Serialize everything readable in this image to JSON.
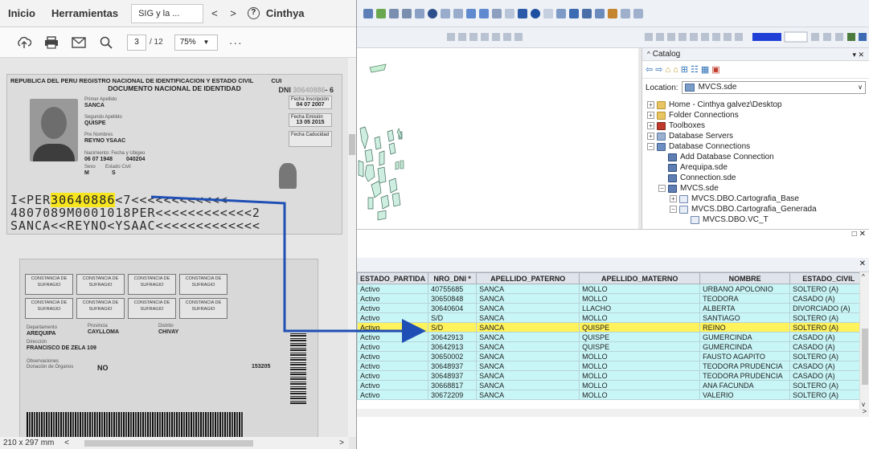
{
  "pdf": {
    "menu": {
      "inicio": "Inicio",
      "herramientas": "Herramientas",
      "tab": "SIG y la ...",
      "nav": "< >",
      "help": "?",
      "user": "Cinthya"
    },
    "toolbar": {
      "page_current": "3",
      "page_total": "/ 12",
      "zoom": "75%",
      "more": "···"
    },
    "status": {
      "page_size": "210 x 297 mm",
      "scroll_left": "<",
      "scroll_right": ">"
    },
    "dni_front": {
      "header": "REPUBLICA DEL PERU  REGISTRO NACIONAL DE IDENTIFICACION Y ESTADO CIVIL",
      "cui": "CUI",
      "title": "DOCUMENTO NACIONAL DE IDENTIDAD",
      "dni_label": "DNI",
      "dni_suffix": "- 6",
      "primer_apellido_label": "Primer Apellido",
      "primer_apellido": "SANCA",
      "segundo_apellido_label": "Segundo Apellido",
      "segundo_apellido": "QUISPE",
      "prenombres_label": "Pre Nombres",
      "prenombres": "REYNO YSAAC",
      "nacimiento_label": "Nacimiento: Fecha y Ubigeo",
      "nacimiento": "06 07 1948",
      "ubigeo": "040204",
      "sexo_label": "Sexo",
      "sexo": "M",
      "estado_civil_label": "Estado Civil",
      "estado_civil": "S",
      "fecha_inscripcion_label": "Fecha Inscripción",
      "fecha_inscripcion": "04 07 2007",
      "fecha_emision_label": "Fecha Emisión",
      "fecha_emision": "13 05 2015",
      "fecha_caducidad_label": "Fecha Caducidad",
      "mrz1_pre": "I<PER",
      "mrz1_hl": "30640886",
      "mrz1_post": "<7<<<<<<<<<<<<",
      "mrz2": "4807089M0001018PER<<<<<<<<<<<<2",
      "mrz3": "SANCA<<REYNO<YSAAC<<<<<<<<<<<<<"
    },
    "dni_back": {
      "stamp_text": "CONSTANCIA DE SUFRAGIO",
      "departamento_label": "Departamento",
      "departamento": "AREQUIPA",
      "provincia_label": "Provincia",
      "provincia": "CAYLLOMA",
      "distrito_label": "Distrito",
      "distrito": "CHIVAY",
      "direccion_label": "Dirección",
      "direccion": "FRANCISCO DE ZELA 109",
      "obs_label": "Observaciones",
      "obs": "Donación de Órganos",
      "obs_value": "NO",
      "grupo_code": "153205"
    }
  },
  "arcmap": {
    "catalog": {
      "title": "Catalog",
      "pin": "▾ ✕",
      "location_label": "Location:",
      "location_value": "MVCS.sde",
      "tree": [
        {
          "label": "Home - Cinthya galvez\\Desktop",
          "exp": "+",
          "icon": "folder",
          "indent": 0
        },
        {
          "label": "Folder Connections",
          "exp": "+",
          "icon": "folder",
          "indent": 0
        },
        {
          "label": "Toolboxes",
          "exp": "+",
          "icon": "box",
          "indent": 0
        },
        {
          "label": "Database Servers",
          "exp": "+",
          "icon": "srv",
          "indent": 0
        },
        {
          "label": "Database Connections",
          "exp": "−",
          "icon": "db",
          "indent": 0
        },
        {
          "label": "Add Database Connection",
          "exp": "",
          "icon": "conn",
          "indent": 1
        },
        {
          "label": "Arequipa.sde",
          "exp": "",
          "icon": "conn",
          "indent": 1
        },
        {
          "label": "Connection.sde",
          "exp": "",
          "icon": "conn",
          "indent": 1
        },
        {
          "label": "MVCS.sde",
          "exp": "−",
          "icon": "conn",
          "indent": 1
        },
        {
          "label": "MVCS.DBO.Cartografia_Base",
          "exp": "+",
          "icon": "fc",
          "indent": 2
        },
        {
          "label": "MVCS.DBO.Cartografia_Generada",
          "exp": "−",
          "icon": "fc",
          "indent": 2
        },
        {
          "label": "MVCS.DBO.VC_T",
          "exp": "",
          "icon": "fc",
          "indent": 3
        }
      ]
    },
    "table": {
      "columns": [
        "ESTADO_PARTIDA",
        "NRO_DNI *",
        "APELLIDO_PATERNO",
        "APELLIDO_MATERNO",
        "NOMBRE",
        "ESTADO_CIVIL"
      ],
      "rows": [
        [
          "Activo",
          "40755685",
          "SANCA",
          "MOLLO",
          "URBANO APOLONIO",
          "SOLTERO (A)"
        ],
        [
          "Activo",
          "30650848",
          "SANCA",
          "MOLLO",
          "TEODORA",
          "CASADO (A)"
        ],
        [
          "Activo",
          "30640604",
          "SANCA",
          "LLACHO",
          "ALBERTA",
          "DIVORCIADO (A)"
        ],
        [
          "Activo",
          "S/D",
          "SANCA",
          "MOLLO",
          "SANTIAGO",
          "SOLTERO (A)"
        ],
        [
          "Activo",
          "S/D",
          "SANCA",
          "QUISPE",
          "REINO",
          "SOLTERO (A)"
        ],
        [
          "Activo",
          "30642913",
          "SANCA",
          "QUISPE",
          "GUMERCINDA",
          "CASADO (A)"
        ],
        [
          "Activo",
          "30642913",
          "SANCA",
          "QUISPE",
          "GUMERCINDA",
          "CASADO (A)"
        ],
        [
          "Activo",
          "30650002",
          "SANCA",
          "MOLLO",
          "FAUSTO AGAPITO",
          "SOLTERO (A)"
        ],
        [
          "Activo",
          "30648937",
          "SANCA",
          "MOLLO",
          "TEODORA PRUDENCIA",
          "CASADO (A)"
        ],
        [
          "Activo",
          "30648937",
          "SANCA",
          "MOLLO",
          "TEODORA PRUDENCIA",
          "CASADO (A)"
        ],
        [
          "Activo",
          "30668817",
          "SANCA",
          "MOLLO",
          "ANA FACUNDA",
          "SOLTERO (A)"
        ],
        [
          "Activo",
          "30672209",
          "SANCA",
          "MOLLO",
          "VALERIO",
          "SOLTERO (A)"
        ]
      ],
      "selected_row": 4,
      "close": "✕"
    },
    "panel_close": "□ ✕",
    "colors": {
      "row_bg": "#c8f5f6",
      "selected_bg": "#fff25a",
      "arrow": "#1f4fb4"
    }
  }
}
